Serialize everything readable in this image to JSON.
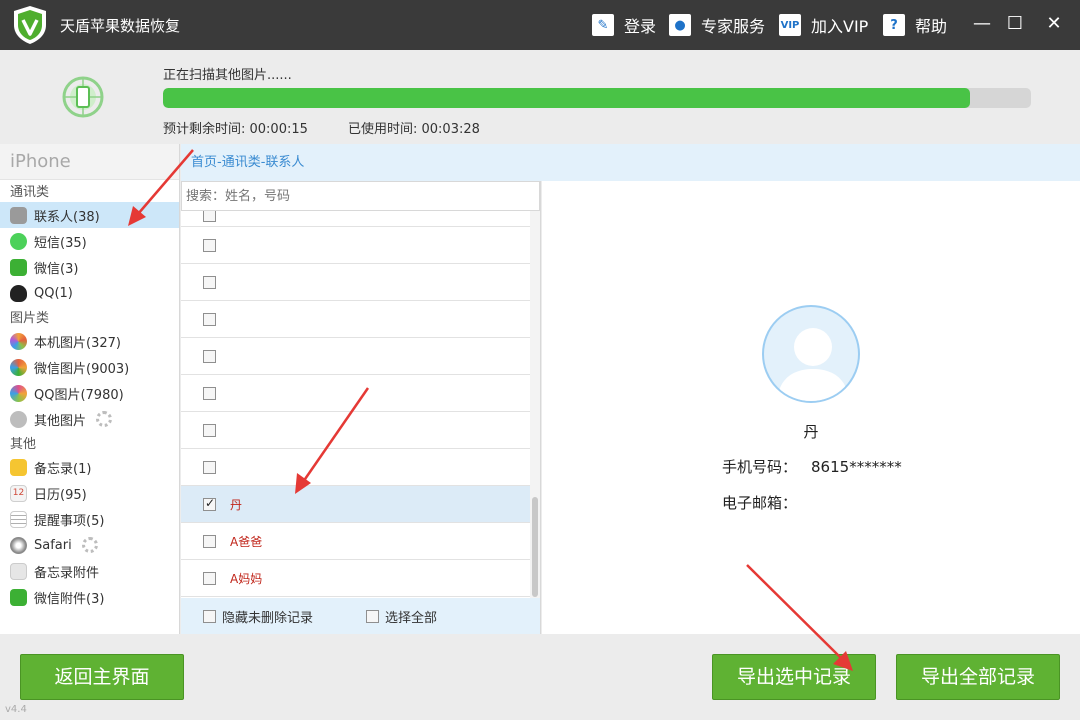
{
  "app": {
    "title": "天盾苹果数据恢复",
    "menu": {
      "login": "登录",
      "expert": "专家服务",
      "vip": "加入VIP",
      "help": "帮助"
    },
    "window_controls": {
      "minimize": "—",
      "maximize": "☐",
      "close": "✕"
    }
  },
  "scan": {
    "status": "正在扫描其他图片......",
    "progress_fraction": 0.93,
    "remaining_label": "预计剩余时间: 00:00:15",
    "elapsed_label": "已使用时间: 00:03:28"
  },
  "sidebar": {
    "device": "iPhone",
    "cat_comm": "通讯类",
    "cat_photo": "图片类",
    "cat_other": "其他",
    "items": [
      {
        "label": "联系人(38)",
        "icon": "contacts-icon",
        "color": "#9a9a9a"
      },
      {
        "label": "短信(35)",
        "icon": "sms-icon",
        "color": "#4cd15a"
      },
      {
        "label": "微信(3)",
        "icon": "wechat-icon",
        "color": "#3cb034"
      },
      {
        "label": "QQ(1)",
        "icon": "qq-icon",
        "color": "#222222"
      },
      {
        "label": "本机图片(327)",
        "icon": "photos-icon",
        "color": "#f2a33a"
      },
      {
        "label": "微信图片(9003)",
        "icon": "wechat-photos-icon",
        "color": "#e5603d"
      },
      {
        "label": "QQ图片(7980)",
        "icon": "qq-photos-icon",
        "color": "#e04f8d"
      },
      {
        "label": "其他图片",
        "icon": "other-photos-icon",
        "color": "#9a9a9a"
      },
      {
        "label": "备忘录(1)",
        "icon": "notes-icon",
        "color": "#f5c531"
      },
      {
        "label": "日历(95)",
        "icon": "calendar-icon",
        "color": "#d9d9d9"
      },
      {
        "label": "提醒事项(5)",
        "icon": "reminders-icon",
        "color": "#b0b0b0"
      },
      {
        "label": "Safari",
        "icon": "safari-icon",
        "color": "#8a8a8a"
      },
      {
        "label": "备忘录附件",
        "icon": "notes-attachment-icon",
        "color": "#c8c8c8"
      },
      {
        "label": "微信附件(3)",
        "icon": "wechat-attachment-icon",
        "color": "#3cb034"
      }
    ]
  },
  "breadcrumb": "首页-通讯类-联系人",
  "list": {
    "search_placeholder": "搜索：姓名，号码",
    "rows": [
      {
        "name": "",
        "checked": false
      },
      {
        "name": "",
        "checked": false
      },
      {
        "name": "",
        "checked": false
      },
      {
        "name": "",
        "checked": false
      },
      {
        "name": "",
        "checked": false
      },
      {
        "name": "",
        "checked": false
      },
      {
        "name": "",
        "checked": false
      },
      {
        "name": "",
        "checked": false
      },
      {
        "name": "丹",
        "checked": true
      },
      {
        "name": "A爸爸",
        "checked": false
      },
      {
        "name": "A妈妈",
        "checked": false
      }
    ],
    "hide_undeleted": "隐藏未删除记录",
    "select_all": "选择全部"
  },
  "detail": {
    "name": "丹",
    "phone_label": "手机号码：",
    "phone_value": "8615*******",
    "email_label": "电子邮箱："
  },
  "buttons": {
    "back": "返回主界面",
    "export_selected": "导出选中记录",
    "export_all": "导出全部记录"
  },
  "version": "v4.4",
  "colors": {
    "accent_green": "#5fb233",
    "progress_green": "#49c346",
    "highlight_blue": "#cde7f9",
    "name_red": "#c0251a",
    "annotation_red": "#e53935"
  }
}
